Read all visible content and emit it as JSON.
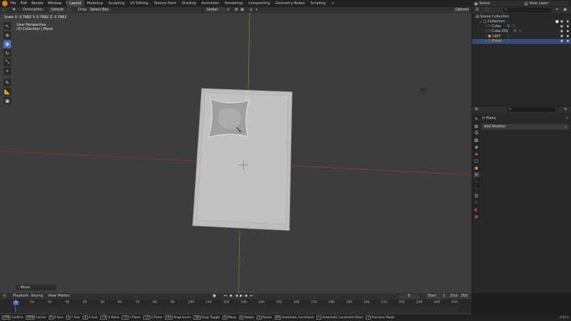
{
  "topbar": {
    "menus": [
      "File",
      "Edit",
      "Render",
      "Window",
      "Help"
    ],
    "workspaces": [
      "Layout",
      "Modeling",
      "Sculpting",
      "UV Editing",
      "Texture Paint",
      "Shading",
      "Animation",
      "Rendering",
      "Compositing",
      "Geometry Nodes",
      "Scripting"
    ],
    "active_workspace": "Layout",
    "add_tab": "+",
    "scene": "Scene",
    "view_layer": "View Layer"
  },
  "viewport_header": {
    "orientation_label": "Orientation:",
    "orientation_value": "Default",
    "drag_label": "Drag:",
    "drag_value": "Select Box",
    "transform_space": "Global",
    "options": "Options"
  },
  "viewport": {
    "status_line": "Scale X: 0.7682   Y: 0.7682   Z: 0.7682",
    "view_name": "User Perspective",
    "collection_info": "(0) Collection | Plane",
    "last_op_panel": "Move"
  },
  "outliner": {
    "root": "Scene Collection",
    "collection": "Collection",
    "items": [
      {
        "name": "Cube",
        "icon_color": "#e8a05b",
        "selected": false
      },
      {
        "name": "Cube.001",
        "icon_color": "#e8a05b",
        "selected": false
      },
      {
        "name": "Light",
        "icon_color": "#e8a05b",
        "selected": false
      },
      {
        "name": "Plane",
        "icon_color": "#e8a05b",
        "selected": true
      }
    ]
  },
  "properties": {
    "object_name": "Plane",
    "add_modifier": "Add Modifier"
  },
  "timeline": {
    "menus": [
      "Playback",
      "Keying",
      "View",
      "Marker"
    ],
    "current_frame": "0",
    "start_label": "Start",
    "start": "1",
    "end_label": "End",
    "end": "250",
    "ticks": [
      "0",
      "10",
      "20",
      "30",
      "40",
      "50",
      "60",
      "70",
      "80",
      "90",
      "100",
      "110",
      "120",
      "130",
      "140",
      "150",
      "160",
      "170",
      "180",
      "190",
      "200",
      "210",
      "220",
      "230",
      "240",
      "250"
    ]
  },
  "statusbar": {
    "items": [
      {
        "key": "LMB",
        "label": "Confirm"
      },
      {
        "key": "RMB",
        "label": "Cancel"
      },
      {
        "key": "X",
        "label": "X Axis"
      },
      {
        "key": "Y",
        "label": "Y Axis"
      },
      {
        "key": "Z",
        "label": "Z Axis"
      },
      {
        "key": "⇧X",
        "label": "X Plane"
      },
      {
        "key": "⇧Y",
        "label": "Y Plane"
      },
      {
        "key": "⇧Z",
        "label": "Z Plane"
      },
      {
        "key": "Ctrl",
        "label": "Snap Invert"
      },
      {
        "key": "Tab",
        "label": "Snap Toggle"
      },
      {
        "key": "G",
        "label": "Move"
      },
      {
        "key": "R",
        "label": "Rotate"
      },
      {
        "key": "S",
        "label": "Resize"
      },
      {
        "key": "Alt",
        "label": "Automatic Constraint"
      },
      {
        "key": "⇧",
        "label": "Automatic Constraint Plane"
      },
      {
        "key": "⇧",
        "label": "Precision Mode"
      }
    ],
    "version": "2.93.1"
  },
  "colors": {
    "accent": "#4772b3",
    "x_axis": "#a8384a",
    "y_axis": "#7aa32e",
    "selected_row": "#334d80"
  }
}
